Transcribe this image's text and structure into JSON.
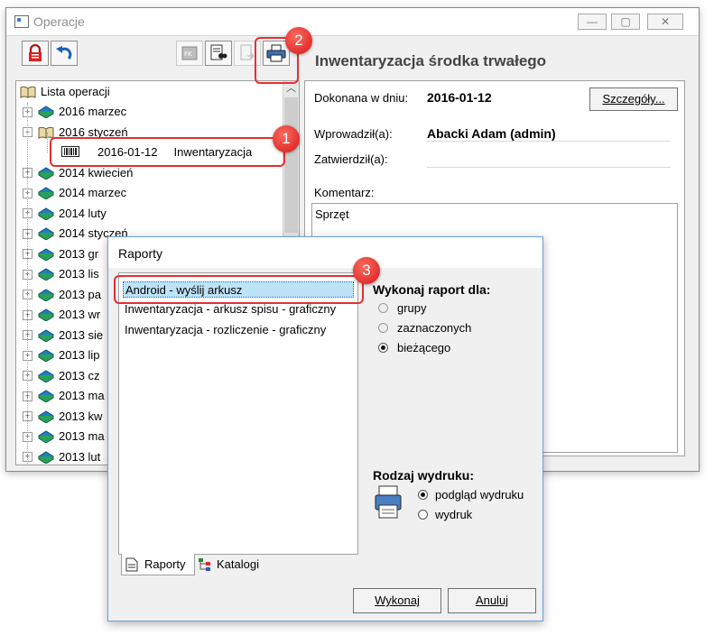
{
  "window": {
    "title": "Operacje"
  },
  "tree": {
    "root": "Lista operacji",
    "items": [
      {
        "label": "2016 marzec"
      },
      {
        "label": "2016 styczeń"
      },
      {
        "label": "2014 kwiecień"
      },
      {
        "label": "2014 marzec"
      },
      {
        "label": "2014 luty"
      },
      {
        "label": "2014 styczeń"
      },
      {
        "label": "2013 gr"
      },
      {
        "label": "2013 lis"
      },
      {
        "label": "2013 pa"
      },
      {
        "label": "2013 wr"
      },
      {
        "label": "2013 sie"
      },
      {
        "label": "2013 lip"
      },
      {
        "label": "2013 cz"
      },
      {
        "label": "2013 ma"
      },
      {
        "label": "2013 kw"
      },
      {
        "label": "2013 ma"
      },
      {
        "label": "2013 lut"
      }
    ],
    "selected_child": {
      "date": "2016-01-12",
      "type": "Inwentaryzacja"
    }
  },
  "detail": {
    "title": "Inwentaryzacja środka trwałego",
    "date_label": "Dokonana w dniu:",
    "date_value": "2016-01-12",
    "details_button": "Szczegóły...",
    "entered_label": "Wprowadził(a):",
    "entered_value": "Abacki Adam (admin)",
    "approved_label": "Zatwierdził(a):",
    "comment_label": "Komentarz:",
    "comment_value": "Sprzęt"
  },
  "dialog": {
    "title": "Raporty",
    "reports": [
      "Android - wyślij arkusz",
      "Inwentaryzacja - arkusz spisu - graficzny",
      "Inwentaryzacja - rozliczenie - graficzny"
    ],
    "run_for_label": "Wykonaj raport dla:",
    "run_for_options": [
      "grupy",
      "zaznaczonych",
      "bieżącego"
    ],
    "print_kind_label": "Rodzaj wydruku:",
    "print_options": [
      "podgląd wydruku",
      "wydruk"
    ],
    "tabs": [
      "Raporty",
      "Katalogi"
    ],
    "execute_button": "Wykonaj",
    "cancel_button": "Anuluj"
  },
  "callouts": [
    "1",
    "2",
    "3"
  ],
  "colors": {
    "callout": "#e33030",
    "selection": "#bde3f7"
  }
}
